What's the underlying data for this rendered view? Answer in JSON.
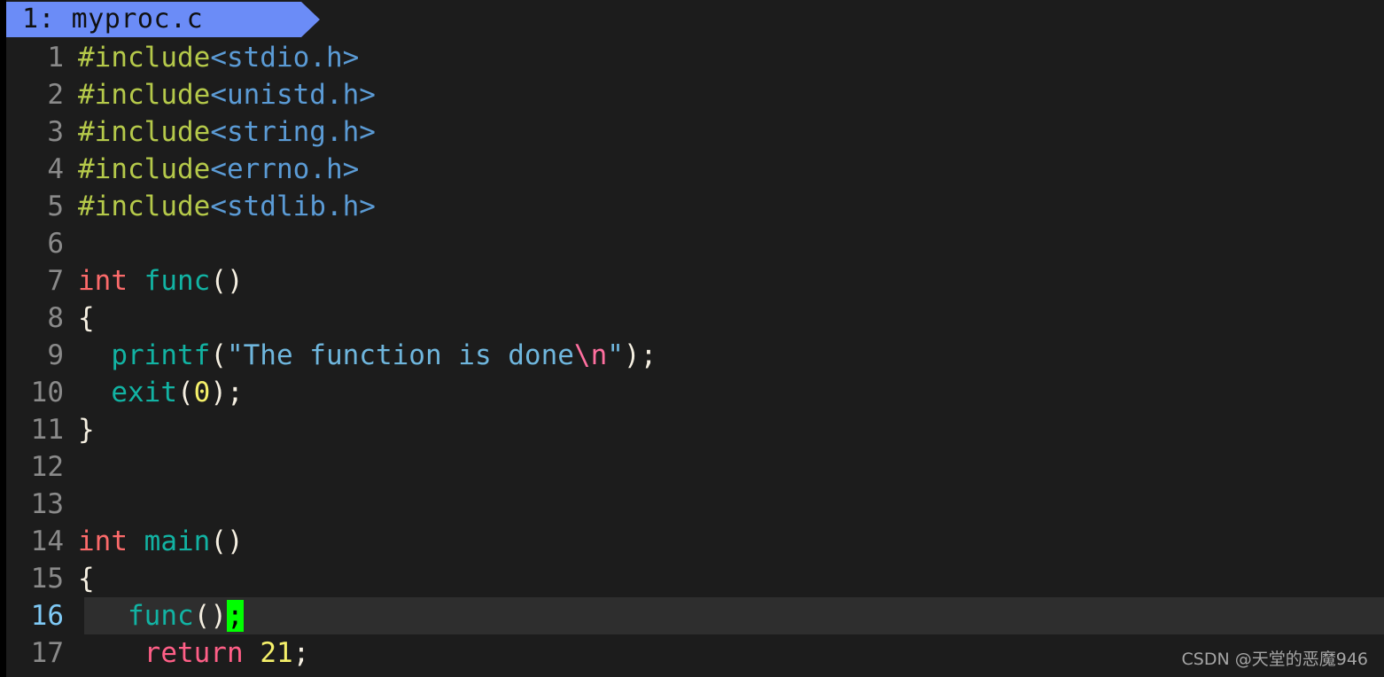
{
  "editor": {
    "tab": {
      "index_label": "1: myproc.c",
      "file_name": "myproc.c",
      "tab_number": "1"
    },
    "background_color": "#1c1c1c",
    "current_line_background": "#2e2e2e",
    "tab_color": "#6b8cf7",
    "cursor_color": "#00ff00",
    "current_line_number": "16",
    "gutter_color": "#8a8a8a",
    "active_lineno_color": "#7fc9f5",
    "lines": [
      {
        "num": "1",
        "active": false,
        "tokens": [
          {
            "cls": "t-pp",
            "text": "#include"
          },
          {
            "cls": "t-header",
            "text": "<stdio.h>"
          }
        ]
      },
      {
        "num": "2",
        "active": false,
        "tokens": [
          {
            "cls": "t-pp",
            "text": "#include"
          },
          {
            "cls": "t-header",
            "text": "<unistd.h>"
          }
        ]
      },
      {
        "num": "3",
        "active": false,
        "tokens": [
          {
            "cls": "t-pp",
            "text": "#include"
          },
          {
            "cls": "t-header",
            "text": "<string.h>"
          }
        ]
      },
      {
        "num": "4",
        "active": false,
        "tokens": [
          {
            "cls": "t-pp",
            "text": "#include"
          },
          {
            "cls": "t-header",
            "text": "<errno.h>"
          }
        ]
      },
      {
        "num": "5",
        "active": false,
        "tokens": [
          {
            "cls": "t-pp",
            "text": "#include"
          },
          {
            "cls": "t-header",
            "text": "<stdlib.h>"
          }
        ]
      },
      {
        "num": "6",
        "active": false,
        "tokens": []
      },
      {
        "num": "7",
        "active": false,
        "tokens": [
          {
            "cls": "t-type",
            "text": "int"
          },
          {
            "cls": "t-punct",
            "text": " "
          },
          {
            "cls": "t-fn",
            "text": "func"
          },
          {
            "cls": "t-punct",
            "text": "()"
          }
        ]
      },
      {
        "num": "8",
        "active": false,
        "tokens": [
          {
            "cls": "t-punct",
            "text": "{"
          }
        ]
      },
      {
        "num": "9",
        "active": false,
        "tokens": [
          {
            "cls": "t-punct",
            "text": "  "
          },
          {
            "cls": "t-fn",
            "text": "printf"
          },
          {
            "cls": "t-punct",
            "text": "("
          },
          {
            "cls": "t-str",
            "text": "\"The function is done"
          },
          {
            "cls": "t-esc",
            "text": "\\n"
          },
          {
            "cls": "t-str",
            "text": "\""
          },
          {
            "cls": "t-punct",
            "text": ");"
          }
        ]
      },
      {
        "num": "10",
        "active": false,
        "tokens": [
          {
            "cls": "t-punct",
            "text": "  "
          },
          {
            "cls": "t-fn",
            "text": "exit"
          },
          {
            "cls": "t-punct",
            "text": "("
          },
          {
            "cls": "t-num",
            "text": "0"
          },
          {
            "cls": "t-punct",
            "text": ");"
          }
        ]
      },
      {
        "num": "11",
        "active": false,
        "tokens": [
          {
            "cls": "t-punct",
            "text": "}"
          }
        ]
      },
      {
        "num": "12",
        "active": false,
        "tokens": []
      },
      {
        "num": "13",
        "active": false,
        "tokens": []
      },
      {
        "num": "14",
        "active": false,
        "tokens": [
          {
            "cls": "t-type",
            "text": "int"
          },
          {
            "cls": "t-punct",
            "text": " "
          },
          {
            "cls": "t-fn",
            "text": "main"
          },
          {
            "cls": "t-punct",
            "text": "()"
          }
        ]
      },
      {
        "num": "15",
        "active": false,
        "tokens": [
          {
            "cls": "t-punct",
            "text": "{"
          }
        ]
      },
      {
        "num": "16",
        "active": true,
        "tokens": [
          {
            "cls": "t-punct",
            "text": "   "
          },
          {
            "cls": "t-fn",
            "text": "func"
          },
          {
            "cls": "t-punct",
            "text": "()"
          },
          {
            "cls": "cursor",
            "text": ";"
          }
        ]
      },
      {
        "num": "17",
        "active": false,
        "tokens": [
          {
            "cls": "t-punct",
            "text": "    "
          },
          {
            "cls": "t-kw",
            "text": "return"
          },
          {
            "cls": "t-punct",
            "text": " "
          },
          {
            "cls": "t-num",
            "text": "21"
          },
          {
            "cls": "t-punct",
            "text": ";"
          }
        ]
      }
    ]
  },
  "watermark": {
    "text": "CSDN @天堂的恶魔946"
  }
}
